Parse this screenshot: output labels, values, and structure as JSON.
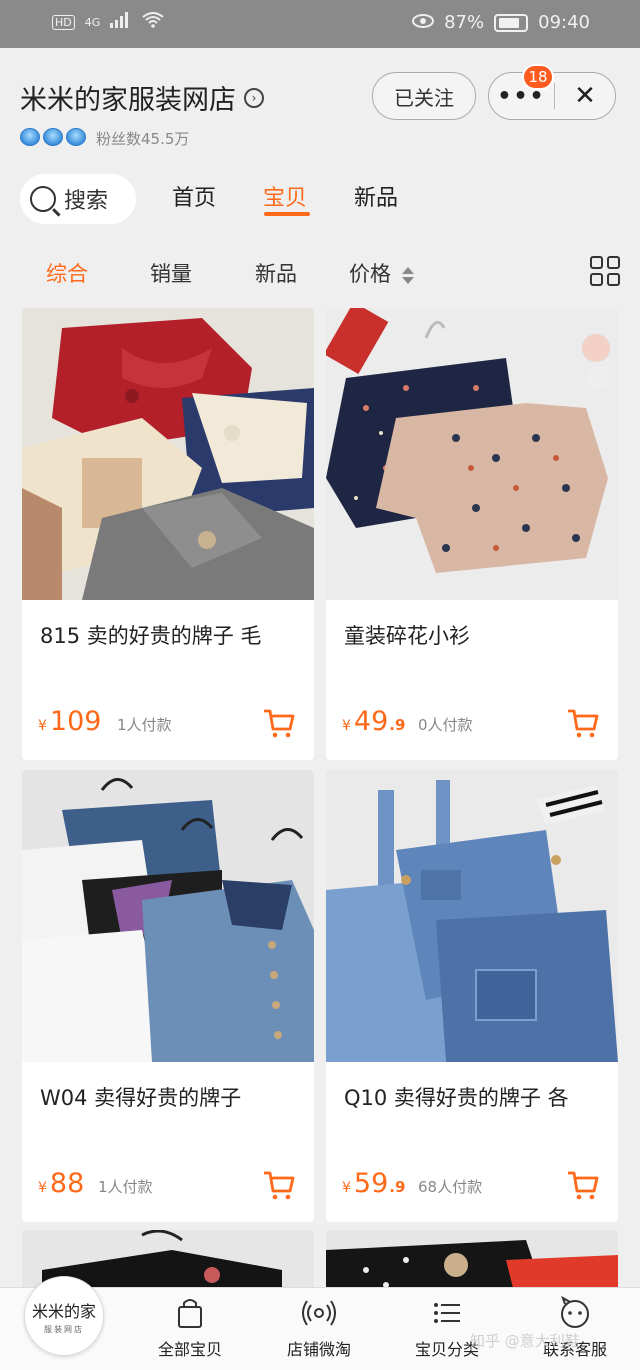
{
  "status_bar": {
    "left_hd": "HD",
    "left_network": "4G",
    "battery_pct": "87%",
    "time": "09:40"
  },
  "store": {
    "name": "米米的家服装网店",
    "fans_label": "粉丝数45.5万",
    "follow_label": "已关注",
    "more_label": "•••",
    "close_label": "✕",
    "notification_count": "18"
  },
  "tabs": {
    "search_label": "搜索",
    "items": [
      "首页",
      "宝贝",
      "新品"
    ],
    "active": "宝贝"
  },
  "sort": {
    "items": [
      "综合",
      "销量",
      "新品",
      "价格"
    ],
    "active": "综合"
  },
  "products": [
    {
      "title": "815 卖的好贵的牌子 毛",
      "price_int": "109",
      "price_dec": "",
      "sold": "1人付款"
    },
    {
      "title": "童装碎花小衫",
      "price_int": "49",
      "price_dec": ".9",
      "sold": "0人付款"
    },
    {
      "title": "W04 卖得好贵的牌子",
      "price_int": "88",
      "price_dec": "",
      "sold": "1人付款"
    },
    {
      "title": "Q10 卖得好贵的牌子 各",
      "price_int": "59",
      "price_dec": ".9",
      "sold": "68人付款"
    }
  ],
  "currency": "¥",
  "colors": {
    "accent": "#ff6a1a",
    "badge": "#ff5a1f"
  },
  "bottom_nav": {
    "logo_line1": "米米的家",
    "logo_line2": "服装网店",
    "items": [
      "全部宝贝",
      "店铺微淘",
      "宝贝分类",
      "联系客服"
    ]
  },
  "watermark": "知乎 @意大利鞋"
}
